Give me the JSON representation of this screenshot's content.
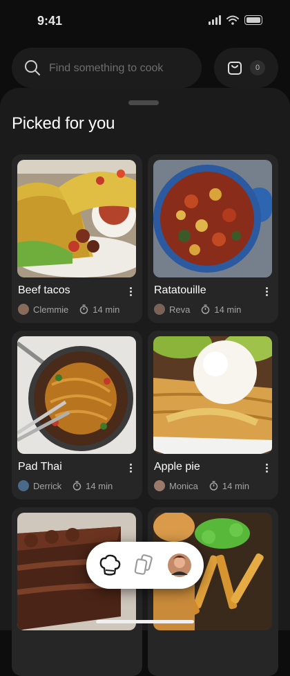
{
  "status_bar": {
    "time": "9:41"
  },
  "search": {
    "placeholder": "Find something to cook"
  },
  "cart": {
    "count": "0"
  },
  "section": {
    "title": "Picked for you"
  },
  "recipes": [
    {
      "title": "Beef tacos",
      "author": "Clemmie",
      "duration": "14 min"
    },
    {
      "title": "Ratatouille",
      "author": "Reva",
      "duration": "14 min"
    },
    {
      "title": "Pad Thai",
      "author": "Derrick",
      "duration": "14 min"
    },
    {
      "title": "Apple pie",
      "author": "Monica",
      "duration": "14 min"
    },
    {
      "title": "",
      "author": "",
      "duration": ""
    },
    {
      "title": "",
      "author": "",
      "duration": ""
    }
  ],
  "bottom_nav": {
    "items": [
      "chef-hat-icon",
      "cards-icon",
      "profile-avatar"
    ]
  },
  "colors": {
    "background": "#0d0d0d",
    "sheet": "#1b1b1b",
    "card": "#262626",
    "nav": "#ffffff"
  }
}
